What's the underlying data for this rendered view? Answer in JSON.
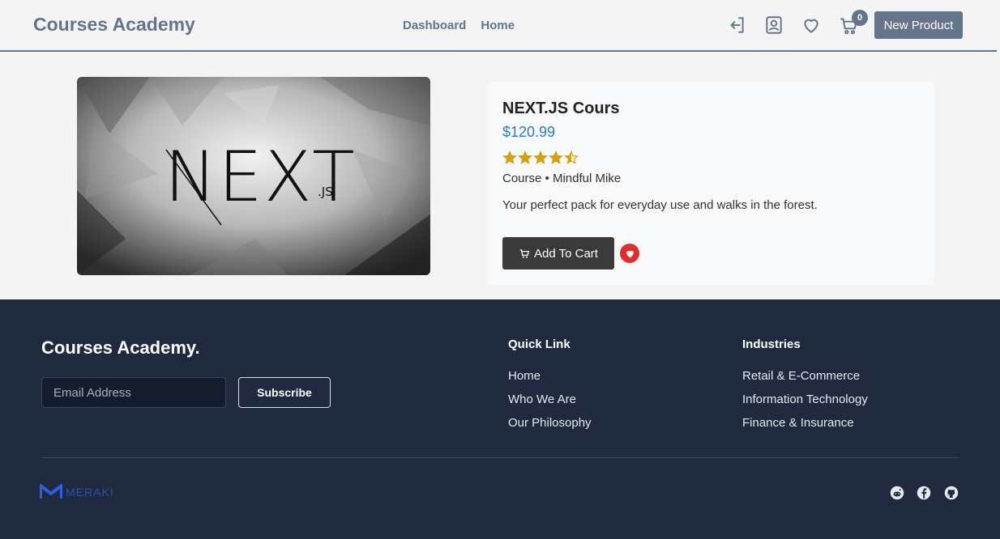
{
  "header": {
    "brand": "Courses Academy",
    "nav": [
      "Dashboard",
      "Home"
    ],
    "cart_count": "0",
    "new_product_label": "New Product",
    "icons": [
      "sign-out-icon",
      "profile-icon",
      "heart-icon",
      "cart-icon"
    ]
  },
  "product": {
    "image_logo_text": "NEXT",
    "image_logo_suffix": ".JS",
    "title": "NEXT.JS Cours",
    "price": "$120.99",
    "rating": 4.5,
    "rating_max": 5,
    "category": "Course",
    "author": "Mindful Mike",
    "meta_separator": "•",
    "description": "Your perfect pack for everyday use and walks in the forest.",
    "add_to_cart_label": "Add To Cart"
  },
  "footer": {
    "brand": "Courses Academy.",
    "email_placeholder": "Email Address",
    "subscribe_label": "Subscribe",
    "quick_link": {
      "title": "Quick Link",
      "links": [
        "Home",
        "Who We Are",
        "Our Philosophy"
      ]
    },
    "industries": {
      "title": "Industries",
      "links": [
        "Retail & E-Commerce",
        "Information Technology",
        "Finance & Insurance"
      ]
    },
    "logo_text": "MERAKI",
    "social": [
      "reddit-icon",
      "facebook-icon",
      "github-icon"
    ]
  },
  "colors": {
    "slate": "#64748b",
    "price_blue": "#2b7bc4",
    "star_gold": "#d4a017",
    "fav_red": "#dc2f2f",
    "footer_bg": "#1f2a3f"
  }
}
